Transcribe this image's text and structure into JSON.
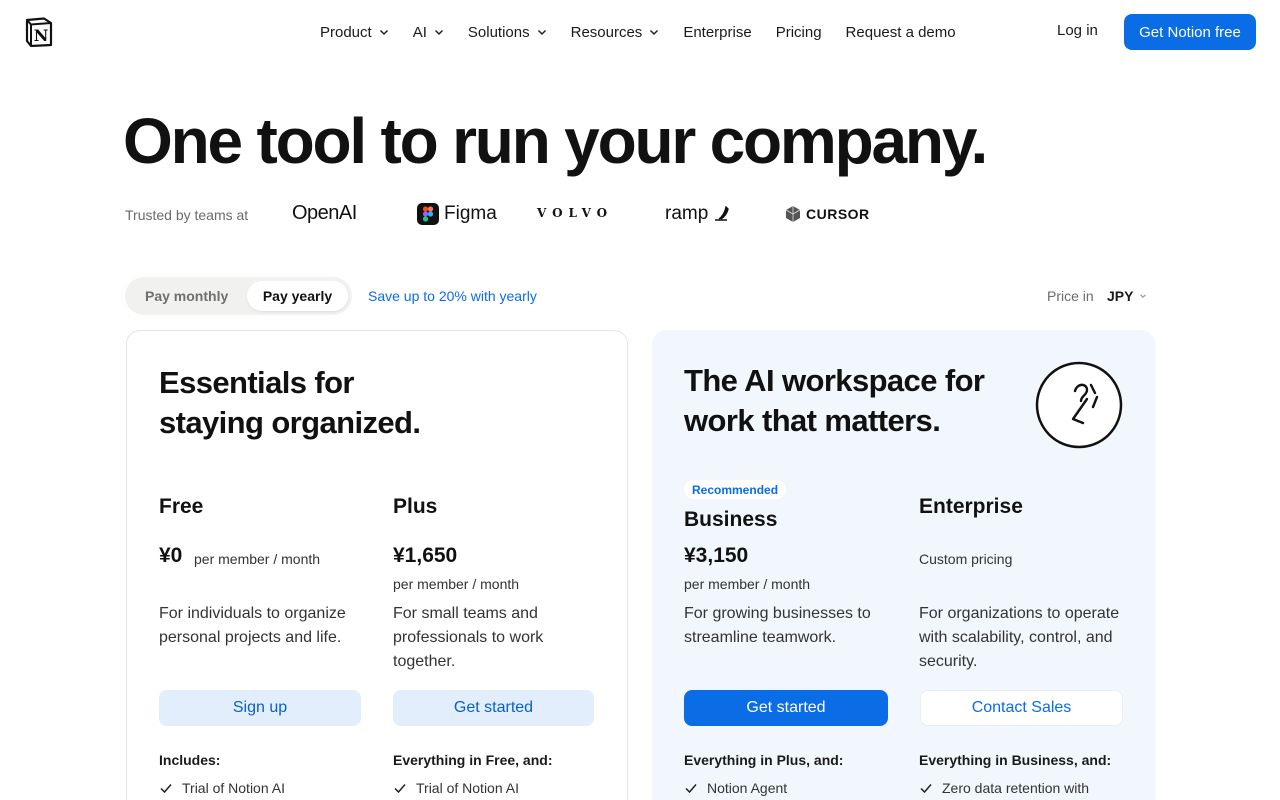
{
  "nav": {
    "items": [
      {
        "label": "Product",
        "dropdown": true
      },
      {
        "label": "AI",
        "dropdown": true
      },
      {
        "label": "Solutions",
        "dropdown": true
      },
      {
        "label": "Resources",
        "dropdown": true
      },
      {
        "label": "Enterprise",
        "dropdown": false
      },
      {
        "label": "Pricing",
        "dropdown": false
      },
      {
        "label": "Request a demo",
        "dropdown": false
      }
    ],
    "login": "Log in",
    "cta": "Get Notion free",
    "logo_letter": "N"
  },
  "hero": {
    "title": "One tool to run your company.",
    "trusted": "Trusted by teams at",
    "brands": [
      "OpenAI",
      "Figma",
      "VOLVO",
      "ramp",
      "CURSOR"
    ]
  },
  "billing": {
    "monthly": "Pay monthly",
    "yearly": "Pay yearly",
    "selected": "yearly",
    "save_note": "Save up to 20% with yearly",
    "price_in_label": "Price in",
    "currency": "JPY"
  },
  "left_card": {
    "heading_line1": "Essentials for",
    "heading_line2": "staying organized."
  },
  "right_card": {
    "heading_line1": "The AI workspace for",
    "heading_line2": "work that matters."
  },
  "plans": {
    "free": {
      "name": "Free",
      "price": "¥0",
      "per": "per member / month",
      "desc": "For individuals to organize personal projects and life.",
      "button": "Sign up",
      "features_title": "Includes:",
      "features": [
        "Trial of Notion AI"
      ]
    },
    "plus": {
      "name": "Plus",
      "price": "¥1,650",
      "per": "per member / month",
      "desc": "For small teams and professionals to work together.",
      "button": "Get started",
      "features_title": "Everything in Free, and:",
      "features": [
        "Trial of Notion AI"
      ]
    },
    "business": {
      "badge": "Recommended",
      "name": "Business",
      "price": "¥3,150",
      "per": "per member / month",
      "desc": "For growing businesses to streamline teamwork.",
      "button": "Get started",
      "features_title": "Everything in Plus, and:",
      "features": [
        "Notion Agent"
      ]
    },
    "enterprise": {
      "name": "Enterprise",
      "per": "Custom pricing",
      "desc": "For organizations to operate with scalability, control, and security.",
      "button": "Contact Sales",
      "features_title": "Everything in Business, and:",
      "features": [
        "Zero data retention with"
      ]
    }
  },
  "colors": {
    "accent": "#0a6de6",
    "accent_light_bg": "#e2eefc",
    "right_card_bg": "#f2f7fd"
  },
  "icons": [
    "notion-logo-icon",
    "chevron-down-icon",
    "check-icon",
    "ai-face-icon",
    "figma-icon",
    "ramp-icon",
    "cursor-icon"
  ]
}
